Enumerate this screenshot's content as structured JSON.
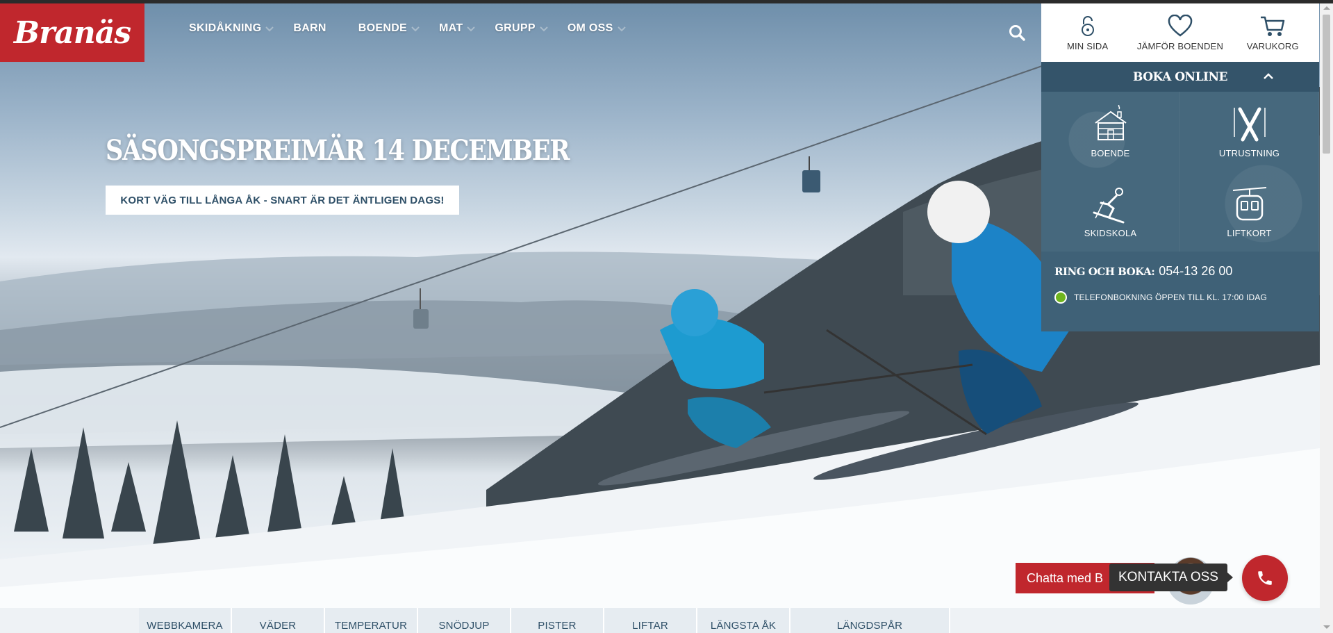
{
  "brand": {
    "logo_text": "Branäs",
    "accent_color": "#c0272d",
    "panel_color": "#3f6177"
  },
  "nav": {
    "items": [
      {
        "label": "SKIDÅKNING",
        "has_dropdown": true
      },
      {
        "label": "BARN",
        "has_dropdown": false
      },
      {
        "label": "BOENDE",
        "has_dropdown": true
      },
      {
        "label": "MAT",
        "has_dropdown": true
      },
      {
        "label": "GRUPP",
        "has_dropdown": true
      },
      {
        "label": "OM OSS",
        "has_dropdown": true
      }
    ],
    "search_icon": "search-icon"
  },
  "utility": {
    "my_page": "MIN SIDA",
    "compare": "JÄMFÖR BOENDEN",
    "cart": "VARUKORG"
  },
  "booking": {
    "title": "BOKA ONLINE",
    "tiles": [
      {
        "label": "BOENDE",
        "icon": "cabin-icon"
      },
      {
        "label": "UTRUSTNING",
        "icon": "skis-icon"
      },
      {
        "label": "SKIDSKOLA",
        "icon": "skier-icon"
      },
      {
        "label": "LIFTKORT",
        "icon": "gondola-icon"
      }
    ],
    "call_label": "RING OCH BOKA:",
    "call_number": "054-13 26 00",
    "open_status": "TELEFONBOKNING ÖPPEN TILL KL. 17:00 IDAG"
  },
  "hero": {
    "title": "SÄSONGSPREIMÄR 14 DECEMBER",
    "cta": "KORT VÄG TILL LÅNGA ÅK - SNART ÄR DET ÄNTLIGEN DAGS!"
  },
  "bottom_tabs": [
    "WEBBKAMERA",
    "VÄDER",
    "TEMPERATUR",
    "SNÖDJUP",
    "PISTER",
    "LIFTAR",
    "LÄNGSTA ÅK",
    "LÄNGDSPÅR"
  ],
  "chat": {
    "label": "Chatta med B"
  },
  "contact": {
    "label": "KONTAKTA OSS"
  }
}
